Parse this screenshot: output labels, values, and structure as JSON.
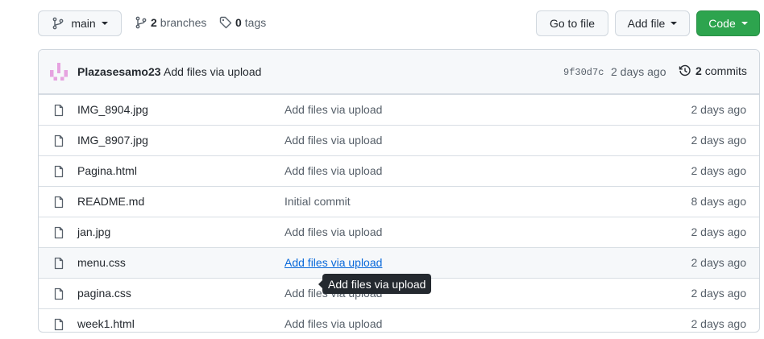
{
  "toolbar": {
    "branch": "main",
    "branches_count": "2",
    "branches_label": "branches",
    "tags_count": "0",
    "tags_label": "tags",
    "go_to_file": "Go to file",
    "add_file": "Add file",
    "code": "Code"
  },
  "commit": {
    "author": "Plazasesamo23",
    "message": "Add files via upload",
    "sha": "9f30d7c",
    "age": "2 days ago",
    "commits_count": "2",
    "commits_label": "commits"
  },
  "files": [
    {
      "name": "IMG_8904.jpg",
      "message": "Add files via upload",
      "age": "2 days ago"
    },
    {
      "name": "IMG_8907.jpg",
      "message": "Add files via upload",
      "age": "2 days ago"
    },
    {
      "name": "Pagina.html",
      "message": "Add files via upload",
      "age": "2 days ago"
    },
    {
      "name": "README.md",
      "message": "Initial commit",
      "age": "8 days ago"
    },
    {
      "name": "jan.jpg",
      "message": "Add files via upload",
      "age": "2 days ago"
    },
    {
      "name": "menu.css",
      "message": "Add files via upload",
      "age": "2 days ago"
    },
    {
      "name": "pagina.css",
      "message": "Add files via upload",
      "age": "2 days ago"
    },
    {
      "name": "week1.html",
      "message": "Add files via upload",
      "age": "2 days ago"
    }
  ],
  "tooltip": "Add files via upload",
  "colors": {
    "code_button": "#2da44e",
    "link": "#0969da",
    "avatar": "#e6a3e0"
  }
}
